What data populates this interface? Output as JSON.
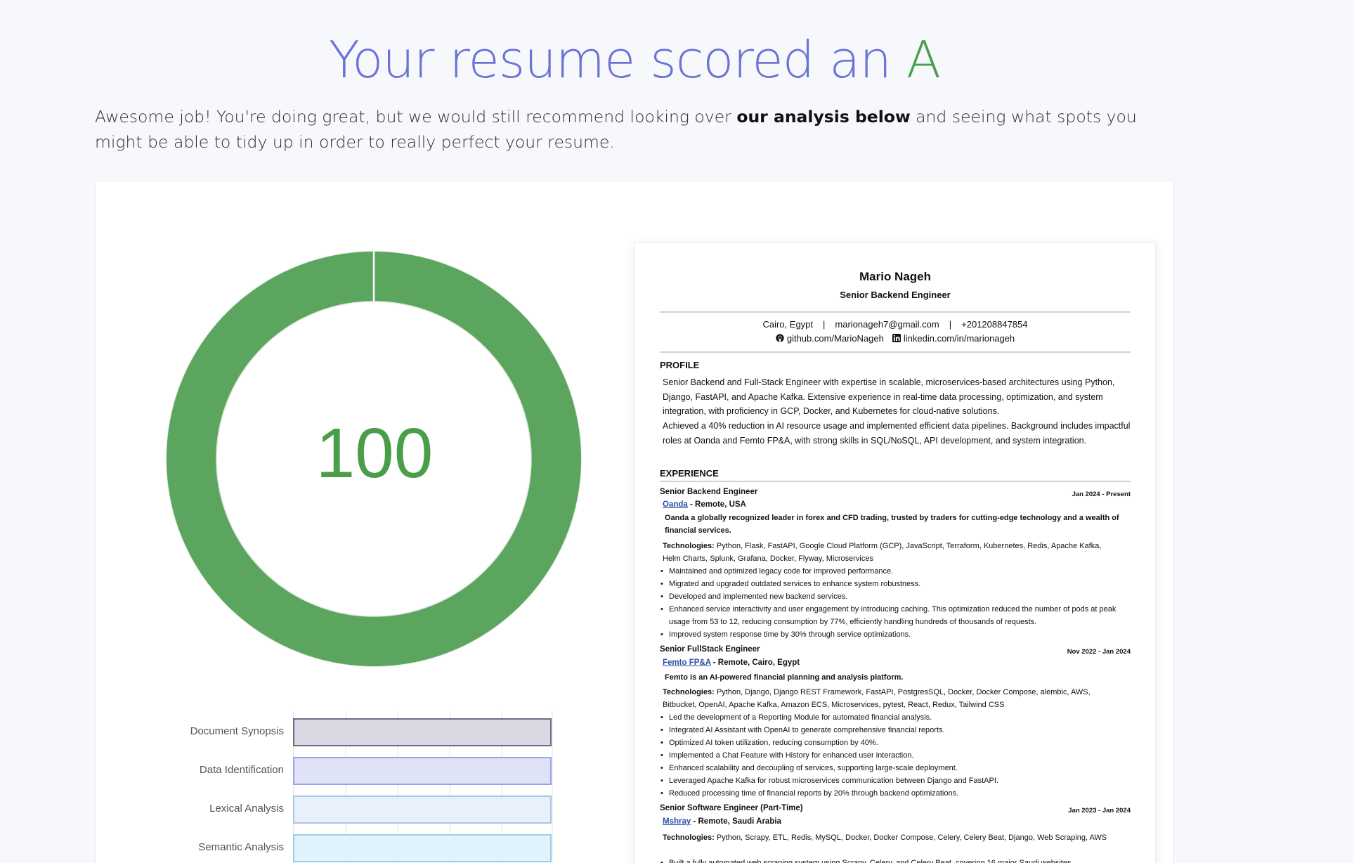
{
  "headline": {
    "prefix": "Your resume scored an ",
    "grade": "A"
  },
  "intro": {
    "part1": "Awesome job! You're doing great, but we would still recommend looking over ",
    "bold": "our analysis below",
    "part2": " and seeing what spots you might be able to tidy up in order to really perfect your resume."
  },
  "score": {
    "value": "100",
    "fraction": 1.0,
    "color": "#5ba55e"
  },
  "bars": [
    {
      "label": "Document Synopsis",
      "fill": "#d8d9e2",
      "border": "#6a6b87"
    },
    {
      "label": "Data Identification",
      "fill": "#e0e3f8",
      "border": "#9aa2e6"
    },
    {
      "label": "Lexical Analysis",
      "fill": "#e8f0fb",
      "border": "#a7c4ea"
    },
    {
      "label": "Semantic Analysis",
      "fill": "#e2f2fb",
      "border": "#96cfee"
    }
  ],
  "resume": {
    "name": "Mario Nageh",
    "role": "Senior Backend Engineer",
    "location": "Cairo, Egypt",
    "email": "marionageh7@gmail.com",
    "phone": "+201208847854",
    "github": "github.com/MarioNageh",
    "linkedin": "linkedin.com/in/marionageh",
    "profile_heading": "PROFILE",
    "profile_p1": "Senior Backend and Full-Stack Engineer with expertise in scalable, microservices-based architectures using Python, Django, FastAPI, and Apache Kafka. Extensive experience in real-time data processing, optimization, and system integration, with proficiency in GCP, Docker, and Kubernetes for cloud-native solutions.",
    "profile_p2": "Achieved a 40% reduction in AI resource usage and implemented efficient data pipelines. Background includes impactful roles at Oanda and Femto FP&A, with strong skills in SQL/NoSQL, API development, and system integration.",
    "experience_heading": "EXPERIENCE",
    "technologies_label": "Technologies:",
    "jobs": [
      {
        "title": "Senior Backend Engineer",
        "dates": "Jan 2024 - Present",
        "company": "Oanda",
        "location": " - Remote, USA",
        "desc": "Oanda a globally recognized leader in forex and CFD trading, trusted by traders for cutting-edge technology and a wealth of financial services.",
        "tech": "Python, Flask, FastAPI, Google Cloud Platform (GCP), JavaScript, Terraform, Kubernetes, Redis, Apache Kafka, Helm Charts, Splunk, Grafana, Docker, Flyway, Microservices",
        "bullets": [
          "Maintained and optimized legacy code for improved performance.",
          "Migrated and upgraded outdated services to enhance system robustness.",
          "Developed and implemented new backend services.",
          "Enhanced service interactivity and user engagement by introducing caching. This optimization reduced the number of pods at peak usage from 53 to 12, reducing consumption by 77%, efficiently handling hundreds of thousands of requests.",
          "Improved system response time by 30% through service optimizations."
        ]
      },
      {
        "title": "Senior FullStack Engineer",
        "dates": "Nov 2022 - Jan 2024",
        "company": "Femto FP&A",
        "location": " - Remote, Cairo, Egypt",
        "desc": "Femto is an AI-powered financial planning and analysis platform.",
        "tech": "Python, Django, Django REST Framework, FastAPI, PostgresSQL, Docker, Docker Compose, alembic, AWS, Bitbucket, OpenAI, Apache Kafka, Amazon ECS, Microservices, pytest, React, Redux, Tailwind CSS",
        "bullets": [
          "Led the development of a Reporting Module for automated financial analysis.",
          "Integrated AI Assistant with OpenAI to generate comprehensive financial reports.",
          "Optimized AI token utilization, reducing consumption by 40%.",
          "Implemented a Chat Feature with History for enhanced user interaction.",
          "Enhanced scalability and decoupling of services, supporting large-scale deployment.",
          "Leveraged Apache Kafka for robust microservices communication between Django and FastAPI.",
          "Reduced processing time of financial reports by 20% through backend optimizations."
        ]
      },
      {
        "title": "Senior Software Engineer (Part-Time)",
        "dates": "Jan 2023 - Jan 2024",
        "company": "Mshray",
        "location": " - Remote, Saudi Arabia",
        "tech": "Python, Scrapy, ETL, Redis, MySQL, Docker, Docker Compose, Celery, Celery Beat, Django, Web Scraping, AWS",
        "bullets": [
          "Built a fully automated web scraping system using Scrapy, Celery, and Celery Beat, covering 16 major Saudi websites."
        ]
      }
    ]
  }
}
